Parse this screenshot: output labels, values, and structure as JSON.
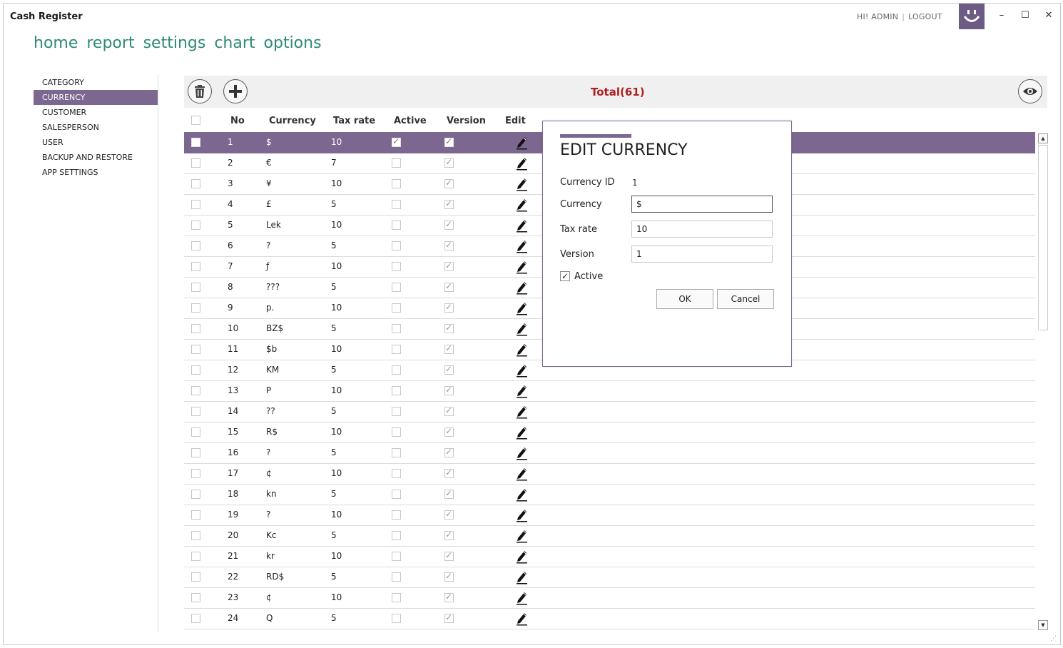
{
  "window": {
    "title": "Cash Register"
  },
  "user": {
    "greeting": "HI! ADMIN",
    "logout_label": "LOGOUT"
  },
  "controls": {
    "minimize": "–",
    "maximize": "☐",
    "close": "✕"
  },
  "nav": {
    "items": [
      "home",
      "report",
      "settings",
      "chart",
      "options"
    ]
  },
  "sidebar": {
    "items": [
      {
        "label": "CATEGORY",
        "active": false
      },
      {
        "label": "CURRENCY",
        "active": true
      },
      {
        "label": "CUSTOMER",
        "active": false
      },
      {
        "label": "SALESPERSON",
        "active": false
      },
      {
        "label": "USER",
        "active": false
      },
      {
        "label": "BACKUP AND RESTORE",
        "active": false
      },
      {
        "label": "APP SETTINGS",
        "active": false
      }
    ]
  },
  "toolbar": {
    "total_label": "Total(61)",
    "delete_icon": "trash-icon",
    "add_icon": "plus-icon",
    "view_icon": "eye-icon"
  },
  "grid": {
    "columns": [
      "No",
      "Currency",
      "Tax rate",
      "Active",
      "Version",
      "Edit"
    ],
    "rows": [
      {
        "no": "1",
        "currency": "$",
        "tax": "10",
        "active": true,
        "version": true,
        "selected": true
      },
      {
        "no": "2",
        "currency": "€",
        "tax": "7",
        "active": false,
        "version": true
      },
      {
        "no": "3",
        "currency": "¥",
        "tax": "10",
        "active": false,
        "version": true
      },
      {
        "no": "4",
        "currency": "£",
        "tax": "5",
        "active": false,
        "version": true
      },
      {
        "no": "5",
        "currency": "Lek",
        "tax": "10",
        "active": false,
        "version": true
      },
      {
        "no": "6",
        "currency": "?",
        "tax": "5",
        "active": false,
        "version": true
      },
      {
        "no": "7",
        "currency": "ƒ",
        "tax": "10",
        "active": false,
        "version": true
      },
      {
        "no": "8",
        "currency": "???",
        "tax": "5",
        "active": false,
        "version": true
      },
      {
        "no": "9",
        "currency": "p.",
        "tax": "10",
        "active": false,
        "version": true
      },
      {
        "no": "10",
        "currency": "BZ$",
        "tax": "5",
        "active": false,
        "version": true
      },
      {
        "no": "11",
        "currency": "$b",
        "tax": "10",
        "active": false,
        "version": true
      },
      {
        "no": "12",
        "currency": "KM",
        "tax": "5",
        "active": false,
        "version": true
      },
      {
        "no": "13",
        "currency": "P",
        "tax": "10",
        "active": false,
        "version": true
      },
      {
        "no": "14",
        "currency": "??",
        "tax": "5",
        "active": false,
        "version": true
      },
      {
        "no": "15",
        "currency": "R$",
        "tax": "10",
        "active": false,
        "version": true
      },
      {
        "no": "16",
        "currency": "?",
        "tax": "5",
        "active": false,
        "version": true
      },
      {
        "no": "17",
        "currency": "¢",
        "tax": "10",
        "active": false,
        "version": true
      },
      {
        "no": "18",
        "currency": "kn",
        "tax": "5",
        "active": false,
        "version": true
      },
      {
        "no": "19",
        "currency": "?",
        "tax": "10",
        "active": false,
        "version": true
      },
      {
        "no": "20",
        "currency": "Kc",
        "tax": "5",
        "active": false,
        "version": true
      },
      {
        "no": "21",
        "currency": "kr",
        "tax": "10",
        "active": false,
        "version": true
      },
      {
        "no": "22",
        "currency": "RD$",
        "tax": "5",
        "active": false,
        "version": true
      },
      {
        "no": "23",
        "currency": "¢",
        "tax": "10",
        "active": false,
        "version": true
      },
      {
        "no": "24",
        "currency": "Q",
        "tax": "5",
        "active": false,
        "version": true
      }
    ]
  },
  "dialog": {
    "title": "EDIT CURRENCY",
    "currency_id_label": "Currency ID",
    "currency_id_value": "1",
    "currency_label": "Currency",
    "currency_value": "$",
    "tax_label": "Tax rate",
    "tax_value": "10",
    "version_label": "Version",
    "version_value": "1",
    "active_label": "Active",
    "active_checked": true,
    "ok_label": "OK",
    "cancel_label": "Cancel"
  },
  "colors": {
    "accent": "#7b6790",
    "nav": "#2e8a77",
    "total": "#b02020"
  }
}
